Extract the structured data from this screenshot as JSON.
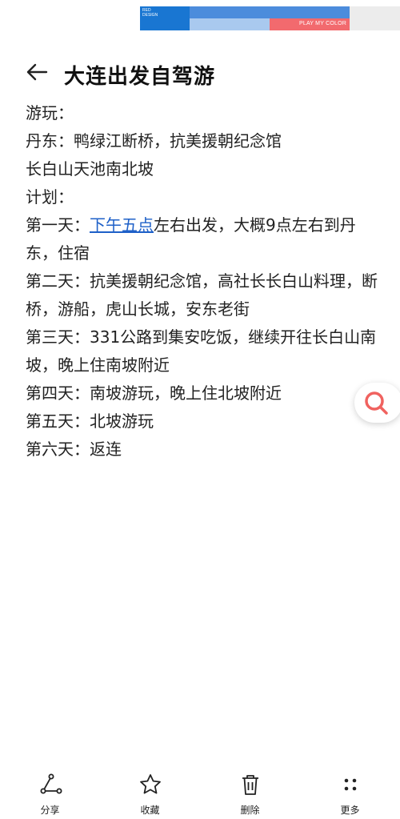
{
  "banner": {
    "brand_text_1": "RED",
    "brand_text_2": "DESIGN",
    "tagline": "PLAY MY COLOR"
  },
  "header": {
    "title": "大连出发自驾游"
  },
  "note": {
    "lines": [
      "游玩：",
      "丹东：鸭绿江断桥，抗美援朝纪念馆",
      "长白山天池南北坡",
      "计划：",
      "第二天：抗美援朝纪念馆，高社长长白山料理，断桥，游船，虎山长城，安东老街",
      "第三天：331公路到集安吃饭，继续开往长白山南坡，晚上住南坡附近",
      "第四天：南坡游玩，晚上住北坡附近",
      "第五天：北坡游玩",
      "第六天：返连"
    ],
    "day1_prefix": "第一天：",
    "day1_link": "下午五点",
    "day1_rest": "左右出发，大概9点左右到丹东，住宿"
  },
  "toolbar": {
    "share": "分享",
    "favorite": "收藏",
    "delete": "删除",
    "more": "更多"
  },
  "colors": {
    "link": "#1e60c8",
    "fab_icon": "#f0625f"
  }
}
